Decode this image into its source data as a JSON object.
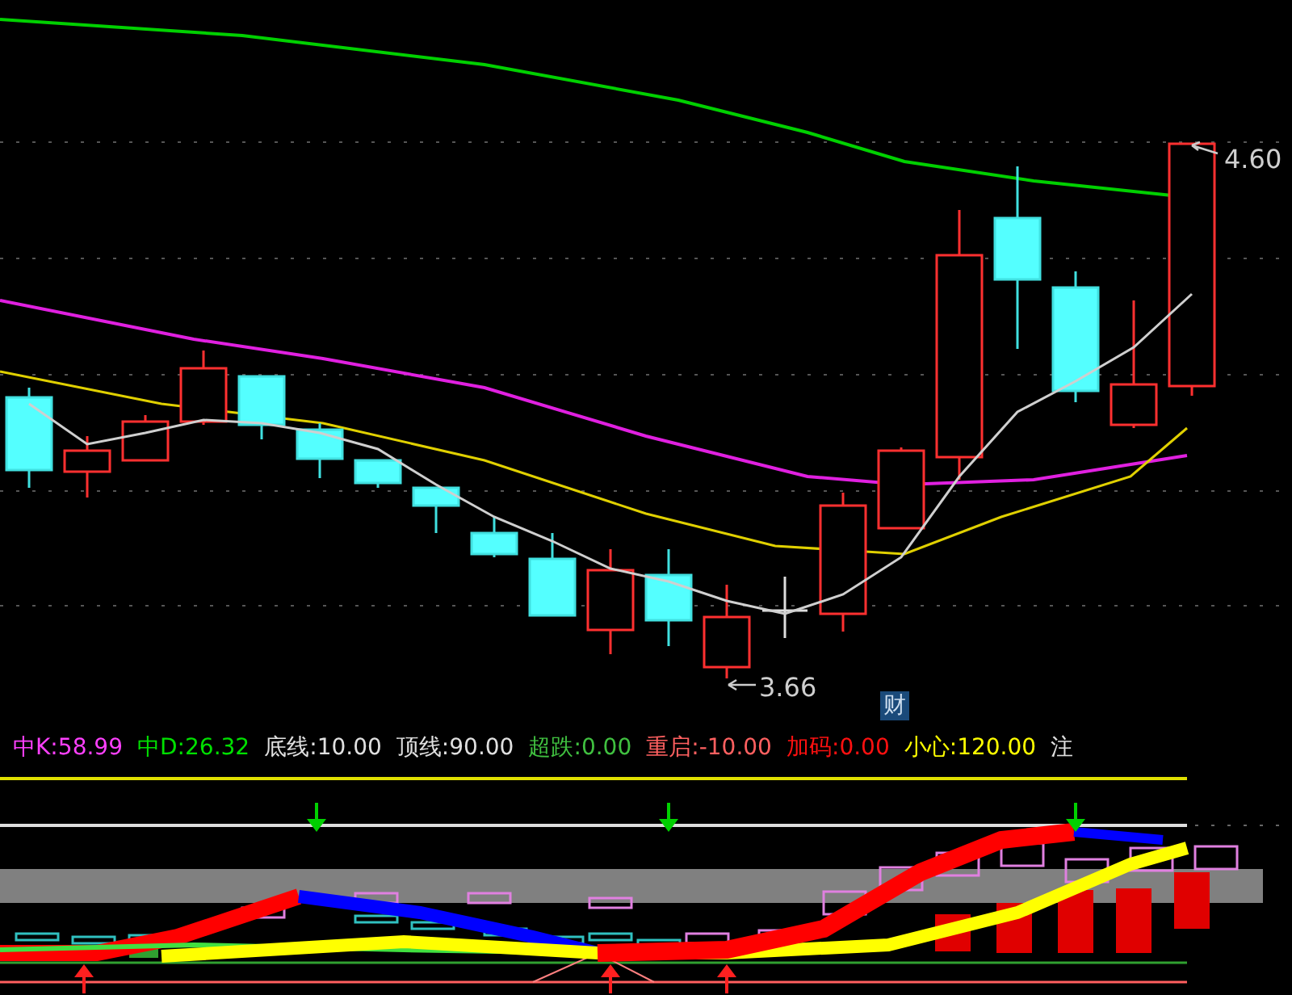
{
  "price_chart": {
    "high_label": "4.60",
    "low_label": "3.66",
    "badge": "财"
  },
  "indicator": {
    "values": [
      {
        "label": "中K:",
        "value": "58.99",
        "color": "#ff40ff"
      },
      {
        "label": "中D:",
        "value": "26.32",
        "color": "#00e000"
      },
      {
        "label": "底线:",
        "value": "10.00",
        "color": "#e0e0e0"
      },
      {
        "label": "顶线:",
        "value": "90.00",
        "color": "#e0e0e0"
      },
      {
        "label": "超跌:",
        "value": "0.00",
        "color": "#40c040"
      },
      {
        "label": "重启:",
        "value": "-10.00",
        "color": "#ff6060"
      },
      {
        "label": "加码:",
        "value": "0.00",
        "color": "#ff1010"
      },
      {
        "label": "小心:",
        "value": "120.00",
        "color": "#ffff00"
      },
      {
        "label": "注",
        "color": "#e0e0e0"
      }
    ]
  }
}
